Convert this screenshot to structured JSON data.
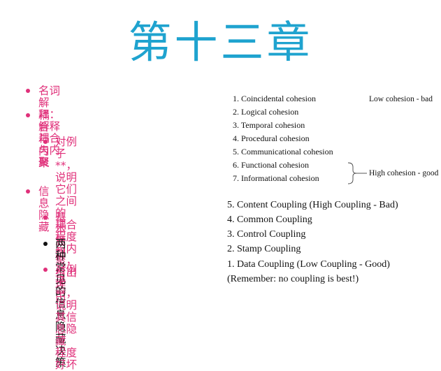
{
  "title": "第十三章",
  "bullets": [
    {
      "text": "名词解释：解释耦合与内聚"
    },
    {
      "text": "耦合与内聚"
    },
    {
      "line1": "对例子**，说明它们之间的",
      "line2": "耦合程度与内聚，给出理",
      "line3": "由"
    },
    {
      "text": "信息隐藏"
    },
    {
      "text": "基本思想"
    },
    {
      "text": "两种常见的信息隐藏决策"
    },
    {
      "line1": "对例子**，说明其信息隐藏",
      "line2": "程度好坏"
    }
  ],
  "colors": {
    "title": "#1fa3cf",
    "accent": "#e0307a",
    "text": "#111111"
  },
  "cohesion": {
    "items": [
      "1. Coincidental cohesion",
      "2. Logical cohesion",
      "3. Temporal cohesion",
      "4. Procedural cohesion",
      "5. Communicational cohesion",
      "6. Functional cohesion",
      "7. Informational cohesion"
    ],
    "low_label": "Low cohesion - bad",
    "high_label": "High cohesion - good"
  },
  "coupling": {
    "items": [
      "5. Content Coupling (High Coupling - Bad)",
      "4. Common Coupling",
      "3. Control Coupling",
      "2. Stamp Coupling",
      "1. Data Coupling (Low Coupling - Good)",
      "(Remember: no coupling is best!)"
    ]
  }
}
